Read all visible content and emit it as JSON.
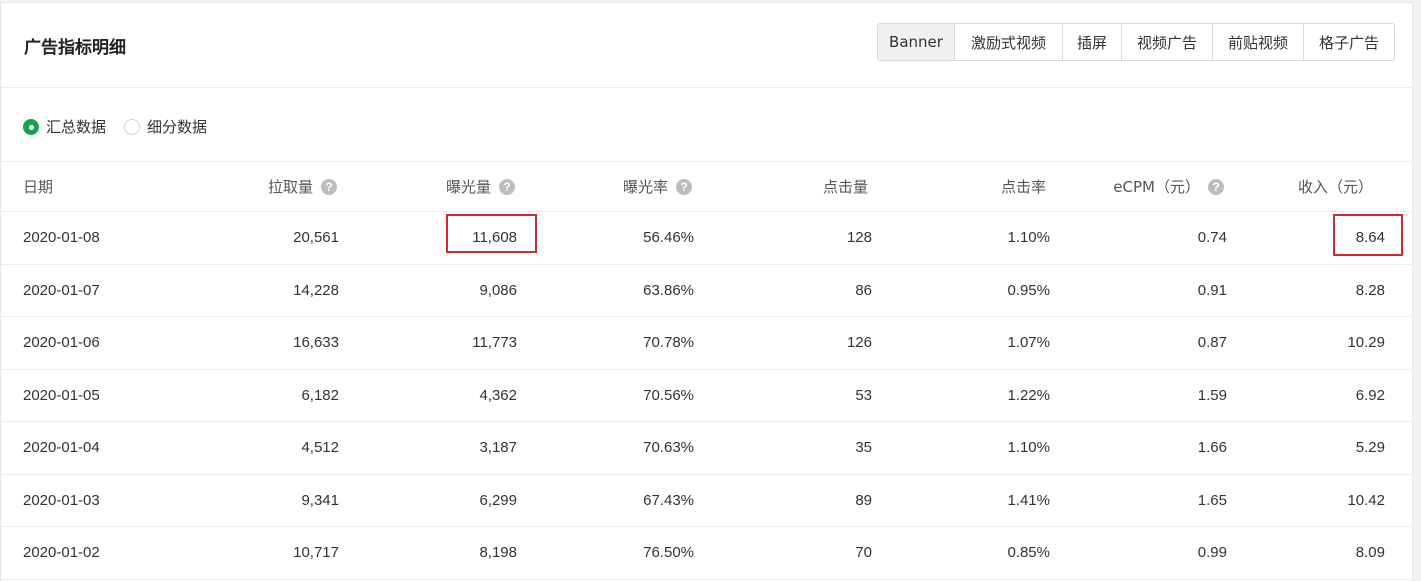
{
  "title": "广告指标明细",
  "tabs": [
    {
      "label": "Banner",
      "active": true
    },
    {
      "label": "激励式视频",
      "active": false
    },
    {
      "label": "插屏",
      "active": false
    },
    {
      "label": "视频广告",
      "active": false
    },
    {
      "label": "前贴视频",
      "active": false
    },
    {
      "label": "格子广告",
      "active": false
    }
  ],
  "radios": [
    {
      "label": "汇总数据",
      "checked": true
    },
    {
      "label": "细分数据",
      "checked": false
    }
  ],
  "columns": [
    {
      "label": "日期",
      "help": false
    },
    {
      "label": "拉取量",
      "help": true
    },
    {
      "label": "曝光量",
      "help": true
    },
    {
      "label": "曝光率",
      "help": true
    },
    {
      "label": "点击量",
      "help": false
    },
    {
      "label": "点击率",
      "help": false
    },
    {
      "label": "eCPM（元）",
      "help": true
    },
    {
      "label": "收入（元）",
      "help": false
    }
  ],
  "rows": [
    [
      "2020-01-08",
      "20,561",
      "11,608",
      "56.46%",
      "128",
      "1.10%",
      "0.74",
      "8.64"
    ],
    [
      "2020-01-07",
      "14,228",
      "9,086",
      "63.86%",
      "86",
      "0.95%",
      "0.91",
      "8.28"
    ],
    [
      "2020-01-06",
      "16,633",
      "11,773",
      "70.78%",
      "126",
      "1.07%",
      "0.87",
      "10.29"
    ],
    [
      "2020-01-05",
      "6,182",
      "4,362",
      "70.56%",
      "53",
      "1.22%",
      "1.59",
      "6.92"
    ],
    [
      "2020-01-04",
      "4,512",
      "3,187",
      "70.63%",
      "35",
      "1.10%",
      "1.66",
      "5.29"
    ],
    [
      "2020-01-03",
      "9,341",
      "6,299",
      "67.43%",
      "89",
      "1.41%",
      "1.65",
      "10.42"
    ],
    [
      "2020-01-02",
      "10,717",
      "8,198",
      "76.50%",
      "70",
      "0.85%",
      "0.99",
      "8.09"
    ]
  ],
  "help_glyph": "?",
  "colors": {
    "accent_green": "#16a34a",
    "highlight_red": "#d9272e"
  }
}
